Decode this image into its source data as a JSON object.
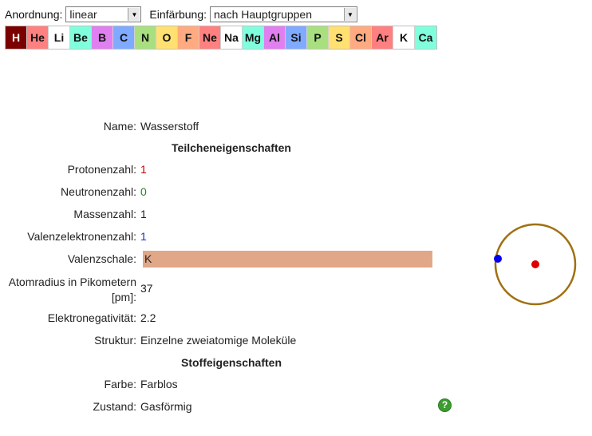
{
  "toolbar": {
    "order_label": "Anordnung:",
    "order_value": "linear",
    "color_label": "Einfärbung:",
    "color_value": "nach Hauptgruppen"
  },
  "elements": [
    {
      "symbol": "H",
      "color": "#7b0000",
      "selected": true
    },
    {
      "symbol": "He",
      "color": "#ff8080"
    },
    {
      "symbol": "Li",
      "color": "#ffffff"
    },
    {
      "symbol": "Be",
      "color": "#80ffdd"
    },
    {
      "symbol": "B",
      "color": "#e080f0"
    },
    {
      "symbol": "C",
      "color": "#80aaff"
    },
    {
      "symbol": "N",
      "color": "#a8e080"
    },
    {
      "symbol": "O",
      "color": "#ffe070"
    },
    {
      "symbol": "F",
      "color": "#ffaa80"
    },
    {
      "symbol": "Ne",
      "color": "#ff8080"
    },
    {
      "symbol": "Na",
      "color": "#ffffff"
    },
    {
      "symbol": "Mg",
      "color": "#80ffdd"
    },
    {
      "symbol": "Al",
      "color": "#e080f0"
    },
    {
      "symbol": "Si",
      "color": "#80aaff"
    },
    {
      "symbol": "P",
      "color": "#a8e080"
    },
    {
      "symbol": "S",
      "color": "#ffe070"
    },
    {
      "symbol": "Cl",
      "color": "#ffaa80"
    },
    {
      "symbol": "Ar",
      "color": "#ff8080"
    },
    {
      "symbol": "K",
      "color": "#ffffff"
    },
    {
      "symbol": "Ca",
      "color": "#80ffdd"
    }
  ],
  "details": {
    "name_label": "Name:",
    "name_value": "Wasserstoff",
    "particle_heading": "Teilcheneigenschaften",
    "protons_label": "Protonenzahl:",
    "protons_value": "1",
    "protons_color": "#cc0000",
    "neutrons_label": "Neutronenzahl:",
    "neutrons_value": "0",
    "neutrons_color": "#228822",
    "mass_label": "Massenzahl:",
    "mass_value": "1",
    "valence_label": "Valenzelektronenzahl:",
    "valence_value": "1",
    "valence_color": "#1133cc",
    "shell_label": "Valenzschale:",
    "shell_value": "K",
    "shell_color": "#e0a888",
    "radius_label_1": "Atomradius in Pikometern",
    "radius_label_2": "[pm]:",
    "radius_value": "37",
    "en_label": "Elektronegativität:",
    "en_value": "2.2",
    "structure_label": "Struktur:",
    "structure_value": "Einzelne zweiatomige Moleküle",
    "material_heading": "Stoffeigenschaften",
    "color_label": "Farbe:",
    "color_value": "Farblos",
    "state_label": "Zustand:",
    "state_value": "Gasförmig",
    "help_icon": "?"
  },
  "atom": {
    "shell_color": "#a07010",
    "nucleus_color": "#dd0000",
    "electron_color": "#0000ee"
  }
}
